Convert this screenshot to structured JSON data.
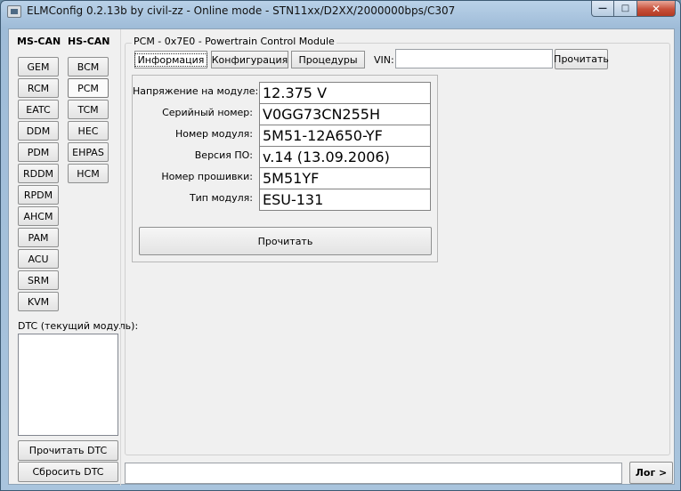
{
  "window": {
    "title": "ELMConfig 0.2.13b by civil-zz - Online mode - STN11xx/D2XX/2000000bps/C307",
    "min_glyph": "—",
    "max_glyph": "□",
    "close_glyph": "✕"
  },
  "sidebar": {
    "ms_can_label": "MS-CAN",
    "hs_can_label": "HS-CAN",
    "ms_can_modules": [
      "GEM",
      "RCM",
      "EATC",
      "DDM",
      "PDM",
      "RDDM",
      "RPDM",
      "AHCM",
      "PAM",
      "ACU",
      "SRM",
      "KVM"
    ],
    "hs_can_modules": [
      "BCM",
      "PCM",
      "TCM",
      "HEC",
      "EHPAS",
      "HCM"
    ],
    "selected_module": "PCM",
    "dtc_label": "DTC (текущий модуль):",
    "read_dtc_button": "Прочитать DTC",
    "clear_dtc_button": "Сбросить DTC"
  },
  "module_panel": {
    "group_title": "PCM - 0x7E0 - Powertrain Control Module",
    "tabs": [
      "Информация",
      "Конфигурация",
      "Процедуры"
    ],
    "active_tab": "Информация",
    "vin_label": "VIN:",
    "vin_value": "",
    "vin_read_button": "Прочитать",
    "fields": [
      {
        "label": "Напряжение на модуле:",
        "value": "12.375 V"
      },
      {
        "label": "Серийный номер:",
        "value": "V0GG73CN255H"
      },
      {
        "label": "Номер модуля:",
        "value": "5M51-12A650-YF"
      },
      {
        "label": "Версия ПО:",
        "value": "v.14 (13.09.2006)"
      },
      {
        "label": "Номер прошивки:",
        "value": "5M51YF"
      },
      {
        "label": "Тип модуля:",
        "value": "ESU-131"
      }
    ],
    "info_read_button": "Прочитать"
  },
  "bottom": {
    "log_value": "",
    "log_button": "Лог >"
  }
}
